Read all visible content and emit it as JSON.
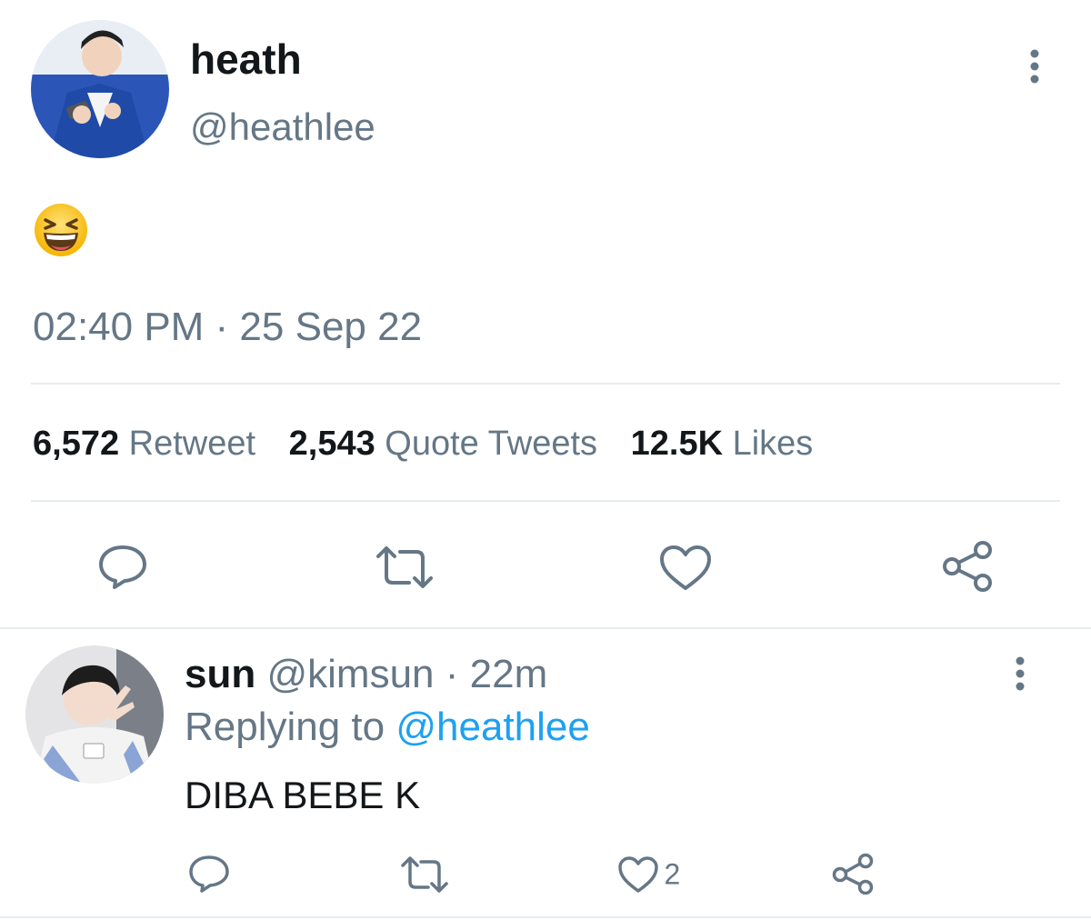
{
  "tweet": {
    "display_name": "heath",
    "handle": "@heathlee",
    "text_emoji": "grinning-squinting-face",
    "timestamp": "02:40 PM · 25 Sep 22",
    "stats": {
      "retweets_count": "6,572",
      "retweets_label": "Retweet",
      "quotes_count": "2,543",
      "quotes_label": "Quote Tweets",
      "likes_count": "12.5K",
      "likes_label": "Likes"
    }
  },
  "reply": {
    "display_name": "sun",
    "handle": "@kimsun",
    "separator": "·",
    "time_ago": "22m",
    "replying_prefix": "Replying to",
    "replying_to": "@heathlee",
    "text": "DIBA BEBE K",
    "like_count": "2"
  },
  "icons": {
    "more": "more-vertical-icon",
    "reply": "reply-icon",
    "retweet": "retweet-icon",
    "like": "heart-icon",
    "share": "share-icon"
  },
  "colors": {
    "text": "#14171a",
    "secondary": "#657786",
    "link": "#1da1f2",
    "divider": "#e6ecf0"
  }
}
